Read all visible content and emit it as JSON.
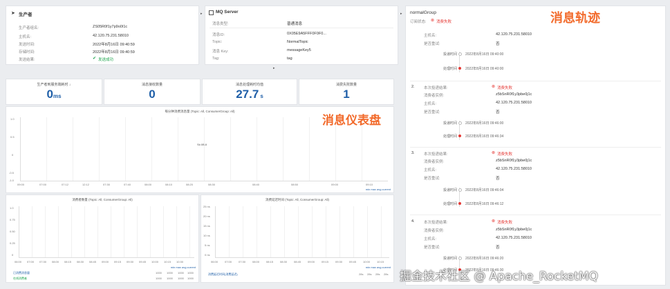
{
  "producer": {
    "title": "生产者",
    "rows": [
      {
        "k": "生产者组名:",
        "v": "ZS05R0f1y7p9o0I1c"
      },
      {
        "k": "主机名:",
        "v": "42.120.75.231.58010"
      },
      {
        "k": "发送时间:",
        "v": "2022年8月16日 09:40:59"
      },
      {
        "k": "存储时间:",
        "v": "2022年8月16日 09:40:59"
      },
      {
        "k": "发送结果:",
        "v": "发送成功"
      }
    ]
  },
  "mq_server": {
    "title": "MQ Server",
    "header_k": "消息类型:",
    "header_v": "普通消息",
    "rows": [
      {
        "k": "消息ID:",
        "v": "0X05E9A5FFF0F0F0..."
      },
      {
        "k": "Topic:",
        "v": "NormalTopic"
      },
      {
        "k": "消息 Key:",
        "v": "messageKey5"
      },
      {
        "k": "Tag:",
        "v": "tag"
      }
    ]
  },
  "stats": [
    {
      "label": "生产者到服务端耗时 ↓",
      "value": "0",
      "unit": "ms"
    },
    {
      "label": "消息接收数量",
      "value": "0",
      "unit": ""
    },
    {
      "label": "消息处理耗时均值",
      "value": "27.7",
      "unit": "s"
    },
    {
      "label": "消费失败数量",
      "value": "1",
      "unit": ""
    }
  ],
  "main_chart": {
    "title": "每分钟消费消息量 (Topic: All, ConsumerGroup: All)",
    "annotation": "Sk:0B.8",
    "x_ticks": [
      "09:00",
      "07:00",
      "07:12",
      "12:12",
      "07:30",
      "07:40",
      "08:00",
      "08:10",
      "08:20",
      "08:30",
      "08:40",
      "08:50",
      "09:00",
      "09:10"
    ],
    "y_ticks": [
      "1.0",
      "0.5",
      "0",
      "-0.5",
      "-1.0"
    ],
    "legend": "min   max   avg   current"
  },
  "bottom_left_chart": {
    "title": "消费者数量 (Topic: All, ConsumerGroup: All)",
    "y_ticks": [
      "1.0",
      "0.75",
      "0.50",
      "0.25",
      "0"
    ],
    "x_ticks": [
      "06:00",
      "07:00",
      "07:30",
      "08:00",
      "08:15",
      "08:30",
      "08:45",
      "09:00",
      "09:15",
      "09:30",
      "09:45",
      "10:00",
      "10:15",
      "10:30"
    ],
    "rows": [
      {
        "name": "已消费消息量",
        "vals": [
          "1000",
          "1000",
          "1000",
          "1000"
        ]
      },
      {
        "name": "在线消费者",
        "vals": [
          "1000",
          "1000",
          "1000",
          "1000"
        ]
      }
    ],
    "legend": "min   max   avg   current"
  },
  "bottom_right_chart": {
    "title": "消费延迟时间 (Topic: All, ConsumerGroup: All)",
    "y_ticks": [
      "0 ns",
      "5 ns",
      "10 ns",
      "15 ns",
      "20 ns",
      "25 ns"
    ],
    "x_ticks": [
      "06:00",
      "07:00",
      "07:30",
      "08:00",
      "08:15",
      "08:30",
      "08:45",
      "09:00",
      "09:15",
      "09:30",
      "09:45",
      "10:00",
      "10:15"
    ],
    "rows": [
      {
        "name": "消费延迟时间(消费延迟)",
        "vals": [
          "28s",
          "28s",
          "28s",
          "28s"
        ]
      }
    ],
    "legend": "min   max   avg   current"
  },
  "trace": {
    "group": "normalGroup",
    "subscribe_k": "订阅状态:",
    "subscribe_v": "消费失败",
    "top": {
      "rows": [
        {
          "k": "主机名:",
          "v": "42.120.75.231.58010"
        },
        {
          "k": "是否重试:",
          "v": "否"
        }
      ],
      "timeline": [
        {
          "k": "投递时间",
          "v": "2022年8月16日 09:40:00"
        },
        {
          "k": "处理时间",
          "v": "2022年8月16日 09:40:00"
        }
      ]
    },
    "attempts": [
      {
        "num": "2.",
        "status": "消费失败",
        "rows": [
          {
            "k": "本次投递结果:",
            "v": ""
          },
          {
            "k": "消费者实例:",
            "v": "z5bSnR0f1y3pbe0j1c"
          },
          {
            "k": "主机名:",
            "v": "42.120.75.231.58010"
          },
          {
            "k": "是否重试:",
            "v": "否"
          }
        ],
        "timeline": [
          {
            "k": "投递时间",
            "v": "2022年8月16日 09:46:00"
          },
          {
            "k": "处理时间",
            "v": "2022年8月16日 09:46:34"
          }
        ]
      },
      {
        "num": "3.",
        "status": "消费失败",
        "rows": [
          {
            "k": "本次投递结果:",
            "v": ""
          },
          {
            "k": "消费者实例:",
            "v": "z5bSnR0f1y3pbe0j1c"
          },
          {
            "k": "主机名:",
            "v": "42.120.75.231.58010"
          },
          {
            "k": "是否重试:",
            "v": "否"
          }
        ],
        "timeline": [
          {
            "k": "投递时间",
            "v": "2022年8月16日 09:46:04"
          },
          {
            "k": "处理时间",
            "v": "2022年8月16日 09:46:12"
          }
        ]
      },
      {
        "num": "4.",
        "status": "消费失败",
        "rows": [
          {
            "k": "本次投递结果:",
            "v": ""
          },
          {
            "k": "消费者实例:",
            "v": "z5bSnR0f1y3pbe0j1c"
          },
          {
            "k": "主机名:",
            "v": "42.120.75.231.58010"
          },
          {
            "k": "是否重试:",
            "v": "否"
          }
        ],
        "timeline": [
          {
            "k": "投递时间",
            "v": "2022年8月16日 09:46:20"
          },
          {
            "k": "处理时间",
            "v": "2022年8月16日 09:46:30"
          }
        ]
      }
    ]
  },
  "labels": {
    "dashboard": "消息仪表盘",
    "trace": "消息轨迹",
    "watermark": "掘金技术社区 @ Apache_RocketMQ"
  },
  "colors": {
    "accent": "#1f5fa8",
    "overlay": "#f26b2c",
    "fail": "#e53935",
    "ok": "#1aa34a"
  }
}
